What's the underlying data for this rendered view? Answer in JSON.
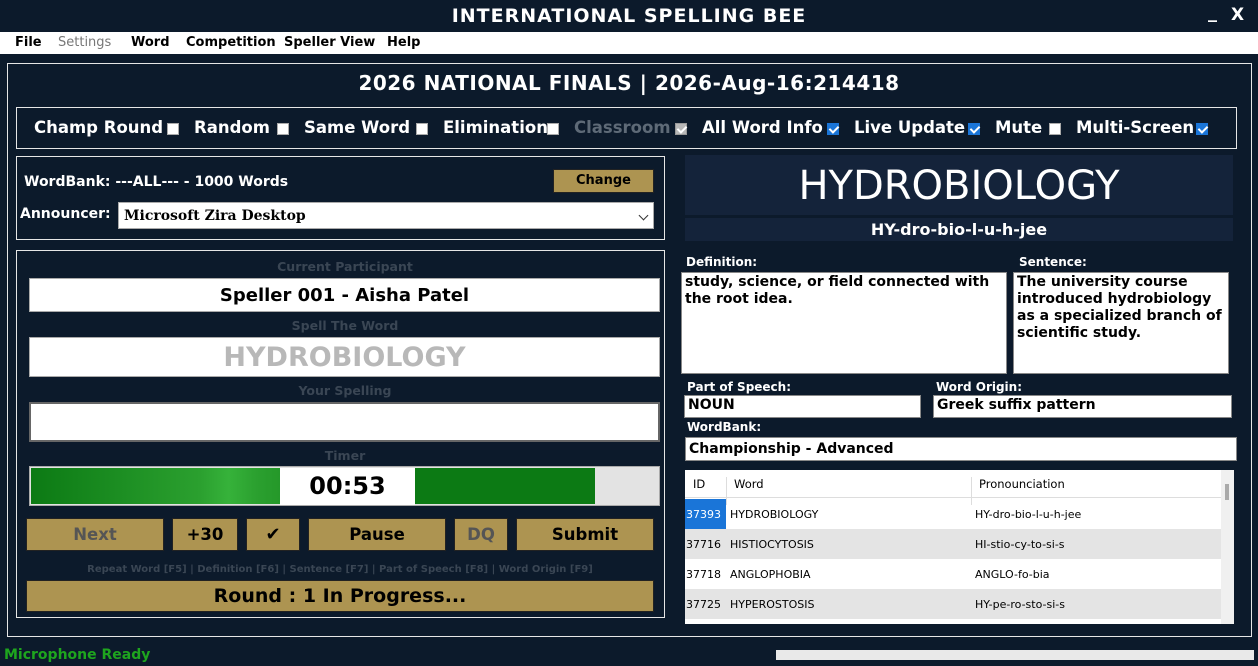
{
  "app": {
    "title": "INTERNATIONAL SPELLING BEE",
    "minimize": "_",
    "close": "X"
  },
  "menu": {
    "file": "File",
    "settings": "Settings",
    "word": "Word",
    "competition": "Competition",
    "speller_view": "Speller View",
    "help": "Help"
  },
  "heading": "2026 NATIONAL FINALS | 2026-Aug-16:214418",
  "options": [
    {
      "label": "Champ Round",
      "checked": false
    },
    {
      "label": "Random",
      "checked": false
    },
    {
      "label": "Same Word",
      "checked": false
    },
    {
      "label": "Elimination",
      "checked": false
    },
    {
      "label": "Classroom",
      "checked": true,
      "disabled": true
    },
    {
      "label": "All Word Info",
      "checked": true
    },
    {
      "label": "Live Update",
      "checked": true
    },
    {
      "label": "Mute",
      "checked": false
    },
    {
      "label": "Multi-Screen",
      "checked": true
    }
  ],
  "setup": {
    "wordbank_text": "WordBank: ---ALL--- - 1000 Words",
    "change_label": "Change",
    "announcer_label": "Announcer:",
    "announcer_value": "Microsoft Zira Desktop"
  },
  "participant": {
    "current_label": "Current Participant",
    "current_value": "Speller 001 - Aisha Patel",
    "spell_label": "Spell The Word",
    "spell_value": "HYDROBIOLOGY",
    "your_spelling_label": "Your Spelling",
    "your_spelling_value": "",
    "timer_label": "Timer",
    "timer_value": "00:53",
    "timer_fraction": 0.9
  },
  "buttons": {
    "next": "Next",
    "plus30": "+30",
    "check": "✔",
    "pause": "Pause",
    "dq": "DQ",
    "submit": "Submit"
  },
  "shortcuts": "Repeat Word [F5] | Definition [F6] | Sentence [F7] | Part of Speech [F8] | Word Origin [F9]",
  "round_status": "Round :  1 In Progress...",
  "word_info": {
    "word": "HYDROBIOLOGY",
    "pronunciation": "HY-dro-bio-l-u-h-jee",
    "definition_label": "Definition:",
    "definition": "study, science, or field connected with the root idea.",
    "sentence_label": "Sentence:",
    "sentence": "The university course introduced hydrobiology as a specialized branch of scientific study.",
    "pos_label": "Part of Speech:",
    "pos": "NOUN",
    "origin_label": "Word Origin:",
    "origin": "Greek suffix pattern",
    "wordbank_label": "WordBank:",
    "wordbank": "Championship - Advanced"
  },
  "table": {
    "headers": [
      "ID",
      "Word",
      "Pronounciation"
    ],
    "rows": [
      [
        "37393",
        "HYDROBIOLOGY",
        "HY-dro-bio-l-u-h-jee"
      ],
      [
        "37716",
        "HISTIOCYTOSIS",
        "HI-stio-cy-to-si-s"
      ],
      [
        "37718",
        "ANGLOPHOBIA",
        "ANGLO-fo-bia"
      ],
      [
        "37725",
        "HYPEROSTOSIS",
        "HY-pe-ro-sto-si-s"
      ]
    ]
  },
  "status": {
    "text": "Microphone Ready",
    "progress": 0
  },
  "colors": {
    "background": "#0c1a2b",
    "gold_button": "#ad9451",
    "timer_green": "#0c7a14",
    "selection_blue": "#1a75d8",
    "status_green": "#1ea51e"
  }
}
